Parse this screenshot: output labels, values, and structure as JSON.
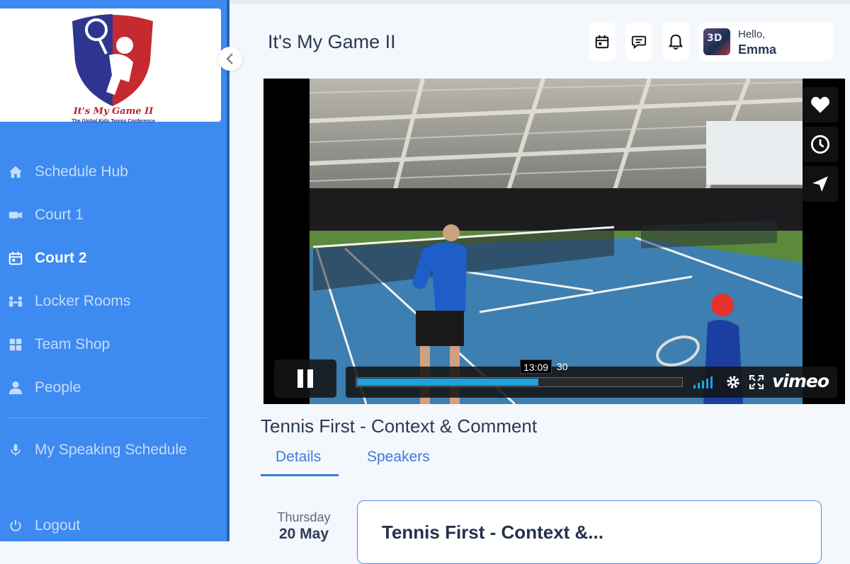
{
  "brand": {
    "logo_title": "It's My Game II",
    "logo_subtitle": "The Global Kids Tennis Conference"
  },
  "sidebar": {
    "items": [
      {
        "label": "Schedule Hub",
        "icon": "home-icon",
        "active": false
      },
      {
        "label": "Court 1",
        "icon": "video-camera-icon",
        "active": false
      },
      {
        "label": "Court 2",
        "icon": "calendar-icon",
        "active": true
      },
      {
        "label": "Locker Rooms",
        "icon": "people-meeting-icon",
        "active": false
      },
      {
        "label": "Team Shop",
        "icon": "grid-icon",
        "active": false
      },
      {
        "label": "People",
        "icon": "person-icon",
        "active": false
      }
    ],
    "secondary": {
      "label": "My Speaking Schedule",
      "icon": "microphone-icon"
    },
    "logout": {
      "label": "Logout",
      "icon": "power-icon"
    }
  },
  "header": {
    "title": "It's My Game II",
    "icons": [
      "calendar-icon",
      "chat-icon",
      "bell-icon"
    ],
    "user": {
      "greeting": "Hello,",
      "name": "Emma",
      "avatar_text": "3D"
    }
  },
  "video": {
    "current_time": "13:09",
    "total_time_visible": "30",
    "progress": 0.56,
    "provider": "vimeo",
    "side_icons": [
      "heart-icon",
      "clock-icon",
      "send-icon"
    ],
    "control_icons": [
      "volume-icon",
      "settings-gear-icon",
      "fullscreen-icon"
    ],
    "state": "playing"
  },
  "session": {
    "title": "Tennis First - Context & Comment",
    "tabs": [
      {
        "label": "Details",
        "active": true
      },
      {
        "label": "Speakers",
        "active": false
      }
    ],
    "day": "Thursday",
    "date": "20 May",
    "card_title": "Tennis First - Context &..."
  },
  "colors": {
    "sidebar": "#3d8af0",
    "accent": "#3b7be0",
    "video_progress": "#1aa3de"
  }
}
